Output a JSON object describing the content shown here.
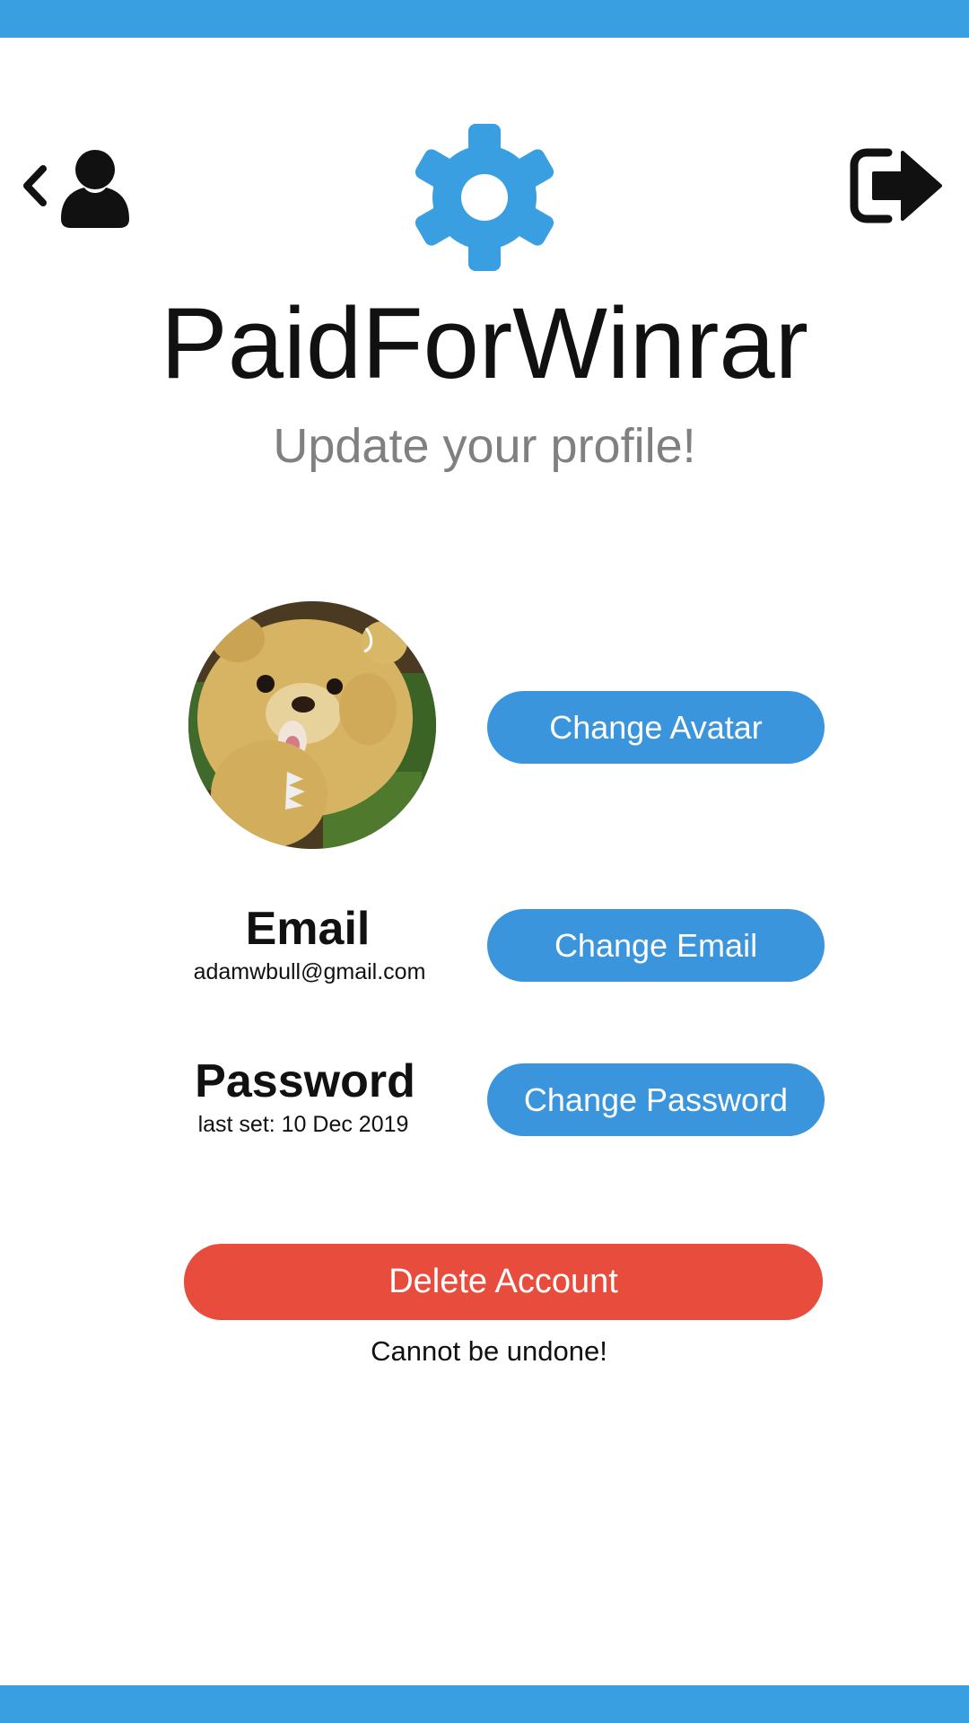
{
  "app": {
    "username": "PaidForWinrar",
    "subtitle": "Update your profile!"
  },
  "header": {
    "back_icon": "chevron-left-icon",
    "profile_icon": "user-icon",
    "settings_icon": "gear-icon",
    "logout_icon": "sign-out-icon"
  },
  "profile": {
    "avatar_alt": "Kon plush avatar",
    "change_avatar_label": "Change Avatar",
    "email": {
      "label": "Email",
      "value": "adamwbull@gmail.com",
      "button_label": "Change Email"
    },
    "password": {
      "label": "Password",
      "value": "last set: 10 Dec 2019",
      "button_label": "Change Password"
    }
  },
  "danger": {
    "delete_label": "Delete Account",
    "warning": "Cannot be undone!"
  },
  "colors": {
    "accent": "#3a9fe0",
    "button_blue": "#3a95dc",
    "danger_red": "#e84c3d",
    "subtitle_gray": "#808080",
    "text": "#111111"
  }
}
